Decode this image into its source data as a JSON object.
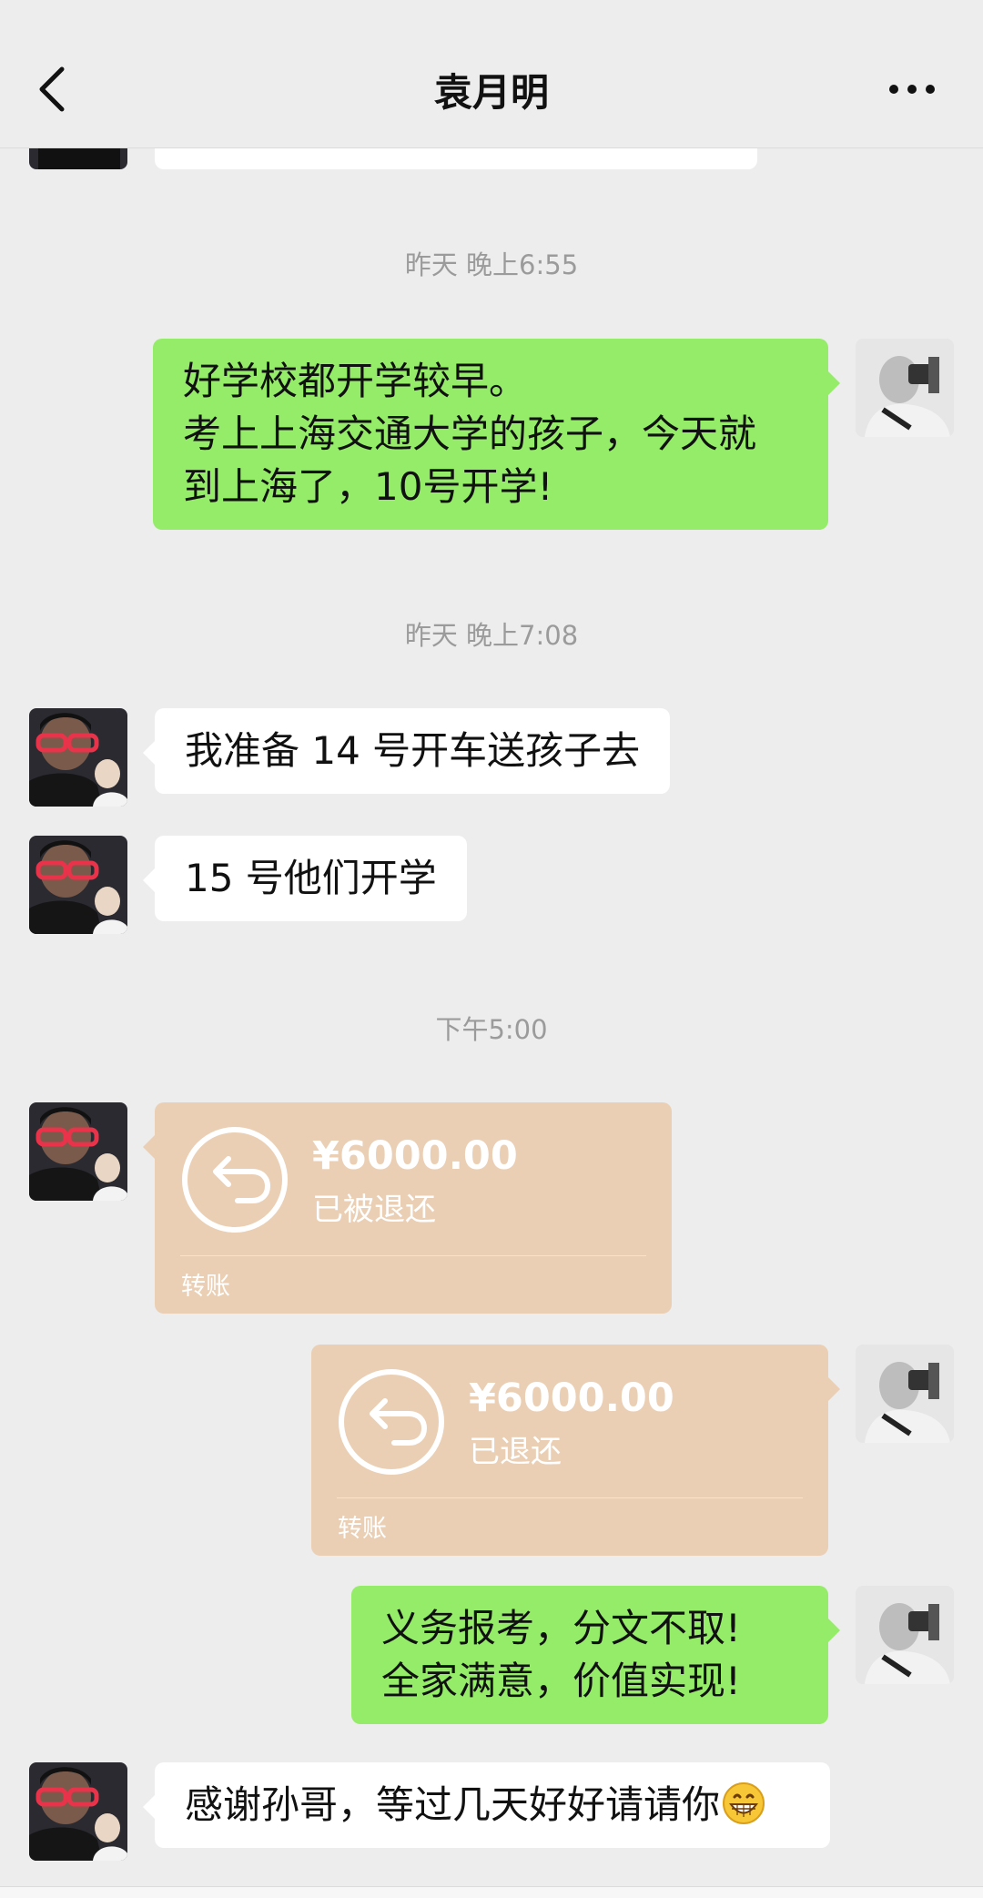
{
  "header": {
    "title": "袁月明"
  },
  "messages": {
    "ts1": "昨天 晚上6:55",
    "m1": {
      "line1": "好学校都开学较早。",
      "line2": "考上上海交通大学的孩子，今天就",
      "line3": "到上海了，10号开学!"
    },
    "ts2": "昨天 晚上7:08",
    "m2": "我准备 14 号开车送孩子去",
    "m3": "15 号他们开学",
    "ts3": "下午5:00",
    "t1": {
      "amount": "¥6000.00",
      "status": "已被退还",
      "label": "转账"
    },
    "t2": {
      "amount": "¥6000.00",
      "status": "已退还",
      "label": "转账"
    },
    "m4": {
      "line1": "义务报考，分文不取!",
      "line2": "全家满意，价值实现!"
    },
    "m5": "感谢孙哥，等过几天好好请请你"
  },
  "icons": {
    "back": "chevron-left-icon",
    "more": "more-dots-icon",
    "transfer": "return-arrow-icon",
    "emoji": "grinning-face-icon"
  },
  "colors": {
    "background": "#ededed",
    "green_bubble": "#95ec69",
    "white_bubble": "#ffffff",
    "transfer_bubble": "#eacfb4",
    "timestamp": "#9b9b9b"
  }
}
